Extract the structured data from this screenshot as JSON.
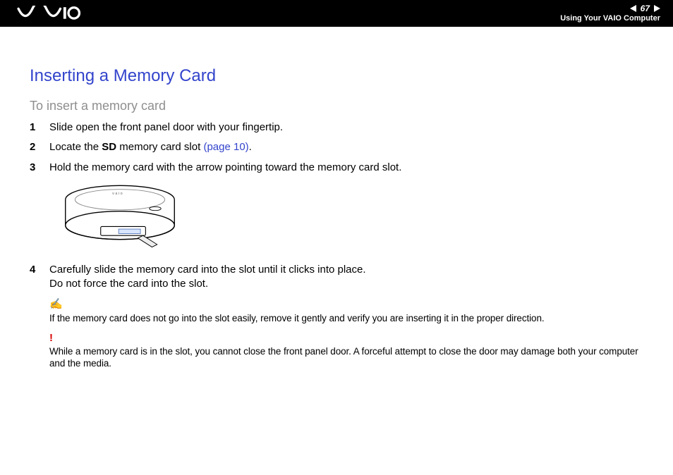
{
  "header": {
    "logo_alt": "VAIO",
    "page_number": "67",
    "section": "Using Your VAIO Computer"
  },
  "page": {
    "title": "Inserting a Memory Card",
    "subtitle": "To insert a memory card",
    "steps": [
      {
        "num": "1",
        "text": "Slide open the front panel door with your fingertip."
      },
      {
        "num": "2",
        "pre": "Locate the ",
        "bold": "SD",
        "mid": " memory card slot ",
        "link": "(page 10)",
        "post": "."
      },
      {
        "num": "3",
        "text": "Hold the memory card with the arrow pointing toward the memory card slot."
      },
      {
        "num": "4",
        "text": "Carefully slide the memory card into the slot until it clicks into place.",
        "text2": "Do not force the card into the slot."
      }
    ],
    "note": "If the memory card does not go into the slot easily, remove it gently and verify you are inserting it in the proper direction.",
    "warning": "While a memory card is in the slot, you cannot close the front panel door. A forceful attempt to close the door may damage both your computer and the media.",
    "note_icon": "✍",
    "warn_icon": "!"
  }
}
